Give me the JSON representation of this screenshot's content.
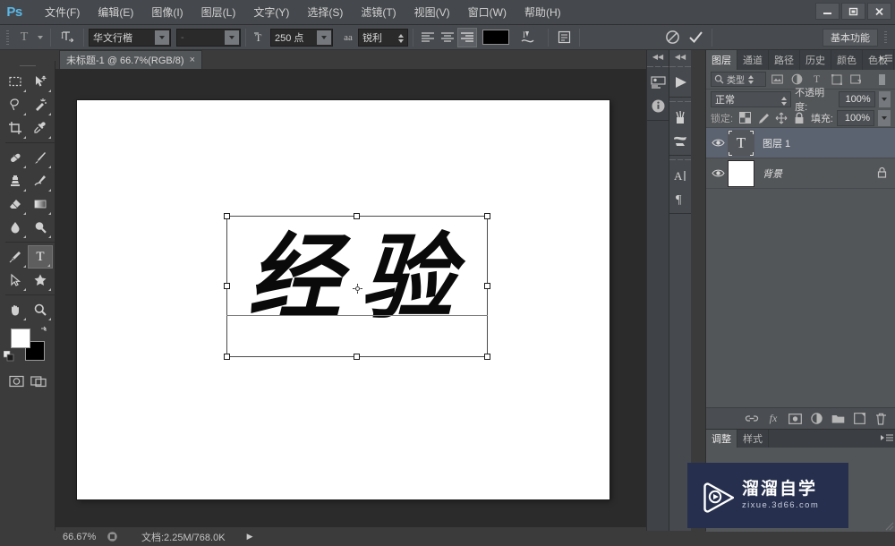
{
  "app": {
    "logo": "Ps",
    "window_buttons": [
      "minimize",
      "restore",
      "close"
    ]
  },
  "menubar": {
    "items": [
      {
        "label": "文件(F)",
        "name": "menu-file"
      },
      {
        "label": "编辑(E)",
        "name": "menu-edit"
      },
      {
        "label": "图像(I)",
        "name": "menu-image"
      },
      {
        "label": "图层(L)",
        "name": "menu-layer"
      },
      {
        "label": "文字(Y)",
        "name": "menu-type"
      },
      {
        "label": "选择(S)",
        "name": "menu-select"
      },
      {
        "label": "滤镜(T)",
        "name": "menu-filter"
      },
      {
        "label": "视图(V)",
        "name": "menu-view"
      },
      {
        "label": "窗口(W)",
        "name": "menu-window"
      },
      {
        "label": "帮助(H)",
        "name": "menu-help"
      }
    ]
  },
  "options_bar": {
    "tool_preset_glyph": "T",
    "orientation_tooltip": "切换文本取向",
    "font_family": "华文行楷",
    "font_style": "-",
    "font_size": "250 点",
    "antialias_glyph": "aa",
    "antialias": "锐利",
    "align": [
      "左对齐文本",
      "居中对齐文本",
      "右对齐文本"
    ],
    "align_active_index": 2,
    "text_color": "#000000",
    "warp_label": "创建文字变形",
    "panels_label": "切换字符和段落面板",
    "cancel_label": "取消所有当前编辑",
    "commit_label": "提交所有当前编辑",
    "workspace": "基本功能"
  },
  "toolbar": {
    "tools": [
      {
        "name": "marquee-tool",
        "glyph": "marquee"
      },
      {
        "name": "move-tool",
        "glyph": "move"
      },
      {
        "name": "lasso-tool",
        "glyph": "lasso"
      },
      {
        "name": "magic-wand-tool",
        "glyph": "wand"
      },
      {
        "name": "crop-tool",
        "glyph": "crop"
      },
      {
        "name": "eyedropper-tool",
        "glyph": "eyedropper"
      },
      {
        "name": "healing-brush-tool",
        "glyph": "healing"
      },
      {
        "name": "brush-tool",
        "glyph": "brush"
      },
      {
        "name": "clone-stamp-tool",
        "glyph": "stamp"
      },
      {
        "name": "history-brush-tool",
        "glyph": "history-brush"
      },
      {
        "name": "eraser-tool",
        "glyph": "eraser"
      },
      {
        "name": "gradient-tool",
        "glyph": "gradient"
      },
      {
        "name": "blur-tool",
        "glyph": "blur"
      },
      {
        "name": "dodge-tool",
        "glyph": "dodge"
      },
      {
        "name": "pen-tool",
        "glyph": "pen"
      },
      {
        "name": "type-tool",
        "glyph": "T"
      },
      {
        "name": "path-selection-tool",
        "glyph": "arrow"
      },
      {
        "name": "custom-shape-tool",
        "glyph": "shape"
      },
      {
        "name": "hand-tool",
        "glyph": "hand"
      },
      {
        "name": "zoom-tool",
        "glyph": "zoom"
      }
    ],
    "active_tool": "type-tool",
    "foreground_color": "#ffffff",
    "background_color": "#000000",
    "quick_mask_label": "以快速蒙版模式编辑",
    "screen_mode_label": "更改屏幕模式"
  },
  "document": {
    "tab_title": "未标题-1 @ 66.7%(RGB/8)",
    "canvas_text": "经验",
    "has_transform_box": true
  },
  "status_bar": {
    "zoom": "66.67%",
    "doc_info": "文档:2.25M/768.0K"
  },
  "dock_left": {
    "icons": [
      {
        "name": "mini-bridge-icon"
      },
      {
        "name": "info-icon"
      }
    ]
  },
  "dock_right": {
    "groups": [
      {
        "icons": [
          {
            "name": "timeline-play-icon"
          }
        ]
      },
      {
        "icons": [
          {
            "name": "brush-icon"
          },
          {
            "name": "brush-presets-icon"
          }
        ]
      },
      {
        "icons": [
          {
            "name": "character-panel-icon"
          },
          {
            "name": "paragraph-panel-icon"
          }
        ]
      }
    ]
  },
  "layers_panel": {
    "tabs": [
      {
        "label": "图层",
        "active": true
      },
      {
        "label": "通道",
        "active": false
      },
      {
        "label": "路径",
        "active": false
      },
      {
        "label": "历史",
        "active": false
      },
      {
        "label": "颜色",
        "active": false
      },
      {
        "label": "色板",
        "active": false
      }
    ],
    "filter": {
      "label": "类型",
      "icons": [
        "pixel-filter-icon",
        "adjustment-filter-icon",
        "type-filter-icon",
        "shape-filter-icon",
        "smart-object-filter-icon"
      ],
      "toggle": "filter-toggle-icon"
    },
    "blend_mode": "正常",
    "opacity_label": "不透明度:",
    "opacity_value": "100%",
    "lock_label": "锁定:",
    "lock_icons": [
      "lock-transparent-pixels",
      "lock-image-pixels",
      "lock-position",
      "lock-all"
    ],
    "fill_label": "填充:",
    "fill_value": "100%",
    "layers": [
      {
        "name": "图层 1",
        "type": "text",
        "visible": true,
        "selected": true,
        "locked": false
      },
      {
        "name": "背景",
        "type": "background",
        "visible": true,
        "selected": false,
        "locked": true
      }
    ],
    "bottom_buttons": [
      {
        "name": "link-layers-button",
        "glyph": "link"
      },
      {
        "name": "layer-style-button",
        "glyph": "fx"
      },
      {
        "name": "layer-mask-button",
        "glyph": "mask"
      },
      {
        "name": "adjustment-layer-button",
        "glyph": "halfcircle"
      },
      {
        "name": "new-group-button",
        "glyph": "folder"
      },
      {
        "name": "new-layer-button",
        "glyph": "newlayer"
      },
      {
        "name": "delete-layer-button",
        "glyph": "trash"
      }
    ]
  },
  "adjustments_panel": {
    "tabs": [
      {
        "label": "调整",
        "active": true
      },
      {
        "label": "样式",
        "active": false
      }
    ]
  },
  "watermark": {
    "title": "溜溜自学",
    "subtitle": "zixue.3d66.com",
    "background_color": "#26304e"
  }
}
